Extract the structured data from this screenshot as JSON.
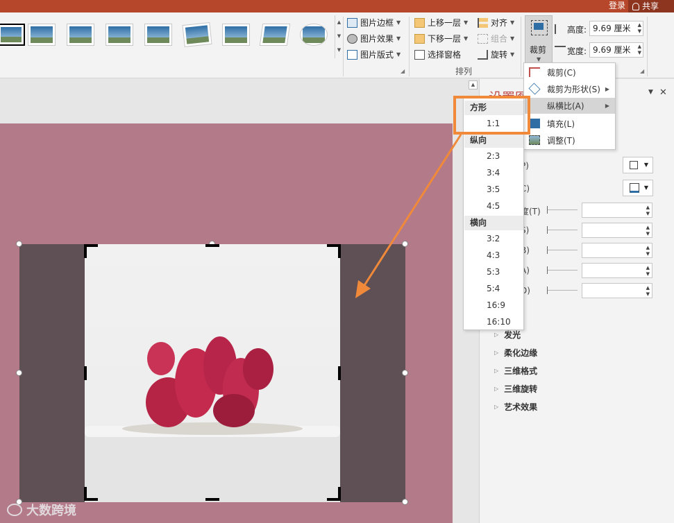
{
  "titlebar": {
    "login": "登录",
    "share": "共享"
  },
  "ribbon": {
    "picture_styles": {
      "border": "图片边框",
      "effects": "图片效果",
      "layout": "图片版式"
    },
    "arrange": {
      "bring_forward": "上移一层",
      "send_backward": "下移一层",
      "selection_pane": "选择窗格",
      "align": "对齐",
      "group": "组合",
      "rotate": "旋转",
      "group_label": "排列"
    },
    "size": {
      "crop": "裁剪",
      "height_label": "高度:",
      "height_value": "9.69 厘米",
      "width_label": "宽度:",
      "width_value": "9.69 厘米"
    }
  },
  "crop_menu": {
    "items": [
      {
        "label": "裁剪(C)"
      },
      {
        "label": "裁剪为形状(S)"
      },
      {
        "label": "纵横比(A)"
      },
      {
        "label": "填充(L)"
      },
      {
        "label": "调整(T)"
      }
    ]
  },
  "aspect_menu": {
    "square_header": "方形",
    "square": [
      "1:1"
    ],
    "portrait_header": "纵向",
    "portrait": [
      "2:3",
      "3:4",
      "3:5",
      "4:5"
    ],
    "landscape_header": "横向",
    "landscape": [
      "3:2",
      "4:3",
      "5:3",
      "5:4",
      "16:9",
      "16:10"
    ]
  },
  "pane": {
    "title": "设置图",
    "labels": [
      "P)",
      "C)",
      "度(T)",
      "S)",
      "B)",
      "A)",
      "D)"
    ],
    "sections": [
      "发光",
      "柔化边缘",
      "三维格式",
      "三维旋转",
      "艺术效果"
    ]
  },
  "watermark": "大数跨境",
  "colors": {
    "accent": "#b7472a",
    "highlight": "#f08a3a",
    "slide_bg": "#b37a89"
  }
}
